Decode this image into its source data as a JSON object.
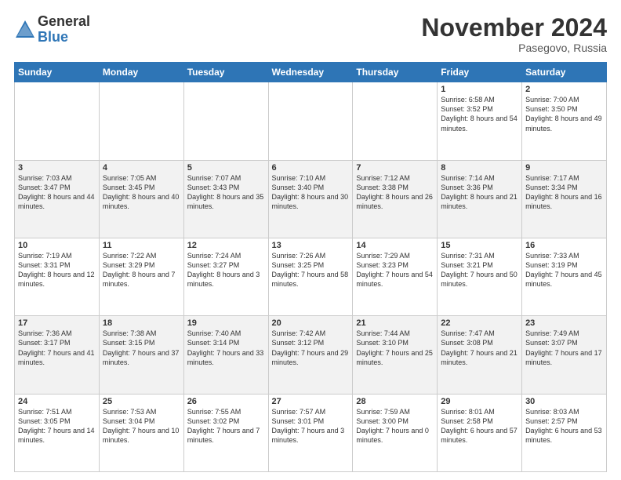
{
  "header": {
    "logo_general": "General",
    "logo_blue": "Blue",
    "month_title": "November 2024",
    "location": "Pasegovo, Russia"
  },
  "weekdays": [
    "Sunday",
    "Monday",
    "Tuesday",
    "Wednesday",
    "Thursday",
    "Friday",
    "Saturday"
  ],
  "weeks": [
    [
      {
        "day": "",
        "info": ""
      },
      {
        "day": "",
        "info": ""
      },
      {
        "day": "",
        "info": ""
      },
      {
        "day": "",
        "info": ""
      },
      {
        "day": "",
        "info": ""
      },
      {
        "day": "1",
        "info": "Sunrise: 6:58 AM\nSunset: 3:52 PM\nDaylight: 8 hours\nand 54 minutes."
      },
      {
        "day": "2",
        "info": "Sunrise: 7:00 AM\nSunset: 3:50 PM\nDaylight: 8 hours\nand 49 minutes."
      }
    ],
    [
      {
        "day": "3",
        "info": "Sunrise: 7:03 AM\nSunset: 3:47 PM\nDaylight: 8 hours\nand 44 minutes."
      },
      {
        "day": "4",
        "info": "Sunrise: 7:05 AM\nSunset: 3:45 PM\nDaylight: 8 hours\nand 40 minutes."
      },
      {
        "day": "5",
        "info": "Sunrise: 7:07 AM\nSunset: 3:43 PM\nDaylight: 8 hours\nand 35 minutes."
      },
      {
        "day": "6",
        "info": "Sunrise: 7:10 AM\nSunset: 3:40 PM\nDaylight: 8 hours\nand 30 minutes."
      },
      {
        "day": "7",
        "info": "Sunrise: 7:12 AM\nSunset: 3:38 PM\nDaylight: 8 hours\nand 26 minutes."
      },
      {
        "day": "8",
        "info": "Sunrise: 7:14 AM\nSunset: 3:36 PM\nDaylight: 8 hours\nand 21 minutes."
      },
      {
        "day": "9",
        "info": "Sunrise: 7:17 AM\nSunset: 3:34 PM\nDaylight: 8 hours\nand 16 minutes."
      }
    ],
    [
      {
        "day": "10",
        "info": "Sunrise: 7:19 AM\nSunset: 3:31 PM\nDaylight: 8 hours\nand 12 minutes."
      },
      {
        "day": "11",
        "info": "Sunrise: 7:22 AM\nSunset: 3:29 PM\nDaylight: 8 hours\nand 7 minutes."
      },
      {
        "day": "12",
        "info": "Sunrise: 7:24 AM\nSunset: 3:27 PM\nDaylight: 8 hours\nand 3 minutes."
      },
      {
        "day": "13",
        "info": "Sunrise: 7:26 AM\nSunset: 3:25 PM\nDaylight: 7 hours\nand 58 minutes."
      },
      {
        "day": "14",
        "info": "Sunrise: 7:29 AM\nSunset: 3:23 PM\nDaylight: 7 hours\nand 54 minutes."
      },
      {
        "day": "15",
        "info": "Sunrise: 7:31 AM\nSunset: 3:21 PM\nDaylight: 7 hours\nand 50 minutes."
      },
      {
        "day": "16",
        "info": "Sunrise: 7:33 AM\nSunset: 3:19 PM\nDaylight: 7 hours\nand 45 minutes."
      }
    ],
    [
      {
        "day": "17",
        "info": "Sunrise: 7:36 AM\nSunset: 3:17 PM\nDaylight: 7 hours\nand 41 minutes."
      },
      {
        "day": "18",
        "info": "Sunrise: 7:38 AM\nSunset: 3:15 PM\nDaylight: 7 hours\nand 37 minutes."
      },
      {
        "day": "19",
        "info": "Sunrise: 7:40 AM\nSunset: 3:14 PM\nDaylight: 7 hours\nand 33 minutes."
      },
      {
        "day": "20",
        "info": "Sunrise: 7:42 AM\nSunset: 3:12 PM\nDaylight: 7 hours\nand 29 minutes."
      },
      {
        "day": "21",
        "info": "Sunrise: 7:44 AM\nSunset: 3:10 PM\nDaylight: 7 hours\nand 25 minutes."
      },
      {
        "day": "22",
        "info": "Sunrise: 7:47 AM\nSunset: 3:08 PM\nDaylight: 7 hours\nand 21 minutes."
      },
      {
        "day": "23",
        "info": "Sunrise: 7:49 AM\nSunset: 3:07 PM\nDaylight: 7 hours\nand 17 minutes."
      }
    ],
    [
      {
        "day": "24",
        "info": "Sunrise: 7:51 AM\nSunset: 3:05 PM\nDaylight: 7 hours\nand 14 minutes."
      },
      {
        "day": "25",
        "info": "Sunrise: 7:53 AM\nSunset: 3:04 PM\nDaylight: 7 hours\nand 10 minutes."
      },
      {
        "day": "26",
        "info": "Sunrise: 7:55 AM\nSunset: 3:02 PM\nDaylight: 7 hours\nand 7 minutes."
      },
      {
        "day": "27",
        "info": "Sunrise: 7:57 AM\nSunset: 3:01 PM\nDaylight: 7 hours\nand 3 minutes."
      },
      {
        "day": "28",
        "info": "Sunrise: 7:59 AM\nSunset: 3:00 PM\nDaylight: 7 hours\nand 0 minutes."
      },
      {
        "day": "29",
        "info": "Sunrise: 8:01 AM\nSunset: 2:58 PM\nDaylight: 6 hours\nand 57 minutes."
      },
      {
        "day": "30",
        "info": "Sunrise: 8:03 AM\nSunset: 2:57 PM\nDaylight: 6 hours\nand 53 minutes."
      }
    ]
  ]
}
